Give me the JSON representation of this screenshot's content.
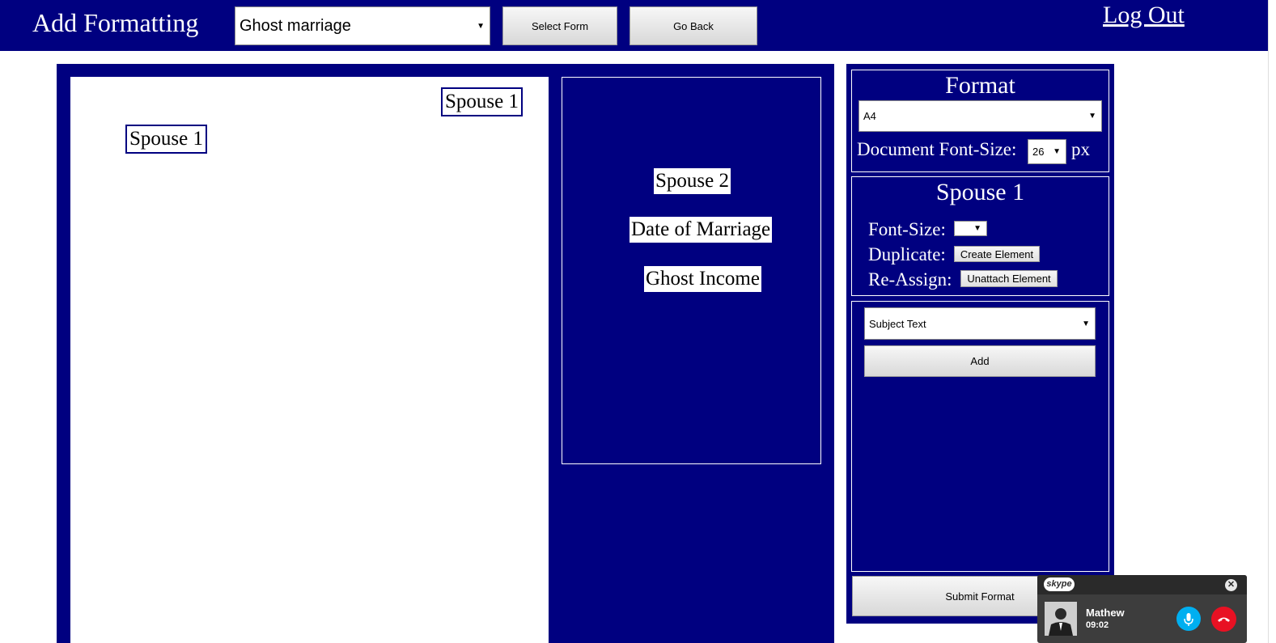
{
  "header": {
    "title": "Add Formatting",
    "form_select_value": "Ghost marriage",
    "select_form_label": "Select Form",
    "go_back_label": "Go Back",
    "logout_label": "Log Out"
  },
  "document": {
    "elements": [
      "Spouse 1",
      "Spouse 1"
    ]
  },
  "available_fields": [
    "Spouse 2",
    "Date of Marriage",
    "Ghost Income"
  ],
  "format_panel": {
    "title": "Format",
    "paper_value": "A4",
    "doc_font_label": "Document Font-Size:",
    "doc_font_value": "26",
    "unit": "px"
  },
  "element_panel": {
    "title": "Spouse 1",
    "font_size_label": "Font-Size:",
    "duplicate_label": "Duplicate:",
    "create_button": "Create Element",
    "reassign_label": "Re-Assign:",
    "unattach_button": "Unattach Element"
  },
  "add_panel": {
    "type_value": "Subject Text",
    "add_label": "Add"
  },
  "submit_label": "Submit Format",
  "skype": {
    "logo": "skype",
    "caller": "Mathew",
    "duration": "09:02"
  },
  "colors": {
    "navy": "#000080",
    "skype_blue": "#00aff0",
    "hangup_red": "#e81123"
  }
}
